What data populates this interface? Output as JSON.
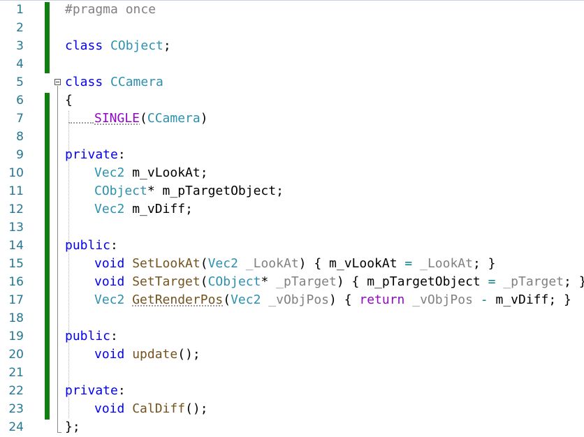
{
  "editor": {
    "language": "C++",
    "lines": [
      {
        "num": "1",
        "text": "#pragma once"
      },
      {
        "num": "2",
        "text": ""
      },
      {
        "num": "3",
        "text": "class CObject;"
      },
      {
        "num": "4",
        "text": ""
      },
      {
        "num": "5",
        "text": "class CCamera"
      },
      {
        "num": "6",
        "text": "{"
      },
      {
        "num": "7",
        "text": "SINGLE(CCamera)"
      },
      {
        "num": "8",
        "text": ""
      },
      {
        "num": "9",
        "text": "private:"
      },
      {
        "num": "10",
        "text": "Vec2 m_vLookAt;"
      },
      {
        "num": "11",
        "text": "CObject* m_pTargetObject;"
      },
      {
        "num": "12",
        "text": "Vec2 m_vDiff;"
      },
      {
        "num": "13",
        "text": ""
      },
      {
        "num": "14",
        "text": "public:"
      },
      {
        "num": "15",
        "text": "void SetLookAt(Vec2 _LookAt) { m_vLookAt = _LookAt; }"
      },
      {
        "num": "16",
        "text": "void SetTarget(CObject* _pTarget) { m_pTargetObject = _pTarget; }"
      },
      {
        "num": "17",
        "text": "Vec2 GetRenderPos(Vec2 _vObjPos) { return _vObjPos - m_vDiff; }"
      },
      {
        "num": "18",
        "text": ""
      },
      {
        "num": "19",
        "text": "public:"
      },
      {
        "num": "20",
        "text": "void update();"
      },
      {
        "num": "21",
        "text": ""
      },
      {
        "num": "22",
        "text": "private:"
      },
      {
        "num": "23",
        "text": "void CalDiff();"
      },
      {
        "num": "24",
        "text": "};"
      }
    ],
    "tokens": {
      "l1_pragma": "#pragma once",
      "kw_class": "class",
      "cobject": "CObject",
      "semi": ";",
      "ccamera": "CCamera",
      "lbrace": "{",
      "single": "SINGLE",
      "lparen": "(",
      "rparen": ")",
      "private": "private",
      "public": "public",
      "colon": ":",
      "vec2": "Vec2",
      "void": "void",
      "m_vLookAt": "m_vLookAt",
      "star": "*",
      "m_pTargetObject": "m_pTargetObject",
      "m_vDiff": "m_vDiff",
      "SetLookAt": "SetLookAt",
      "_LookAt": "_LookAt",
      "assign": "=",
      "rbrace": "}",
      "SetTarget": "SetTarget",
      "_pTarget": "_pTarget",
      "GetRenderPos": "GetRenderPos",
      "_vObjPos": "_vObjPos",
      "return": "return",
      "minus": "-",
      "update": "update",
      "CalDiff": "CalDiff",
      "call_parens": "()",
      "class_end": "};"
    },
    "colors": {
      "keyword": "#0000ff",
      "type": "#2b91af",
      "function": "#74531f",
      "macro": "#8f08c4",
      "parameter": "#808080",
      "operator": "#008080",
      "preprocessor": "#808080",
      "line_number": "#237893",
      "change_bar": "#108010"
    }
  }
}
